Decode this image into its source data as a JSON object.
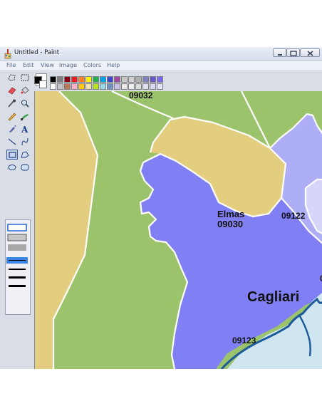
{
  "window": {
    "title": "Untitled - Paint",
    "controls": [
      "minimize-icon",
      "maximize-icon",
      "close-icon"
    ]
  },
  "menu": {
    "items": [
      "File",
      "Edit",
      "View",
      "Image",
      "Colors",
      "Help"
    ]
  },
  "tools": [
    "free-select-icon",
    "rect-select-icon",
    "eraser-icon",
    "fill-bucket-icon",
    "color-picker-icon",
    "magnifier-icon",
    "pencil-icon",
    "brush-icon",
    "airbrush-icon",
    "text-icon",
    "line-icon",
    "curve-icon",
    "rectangle-icon",
    "polygon-icon",
    "ellipse-icon",
    "rounded-rect-icon"
  ],
  "colors": {
    "foreground": "#000000",
    "background": "#ffffff",
    "palette_top": [
      "#000000",
      "#7f7f7f",
      "#880015",
      "#ed1c24",
      "#ff7f27",
      "#fff200",
      "#22b14c",
      "#00a2e8",
      "#3f48cc",
      "#a349a4",
      "#c8c8c8",
      "#d0d0d0",
      "#b0b0b0",
      "#8080c0",
      "#6a5acd",
      "#7b68ee"
    ],
    "palette_bottom": [
      "#ffffff",
      "#c3c3c3",
      "#b97a57",
      "#ffaec9",
      "#ffc90e",
      "#efe4b0",
      "#b5e61d",
      "#99d9ea",
      "#7092be",
      "#c8bfe7",
      "#e8e8e8",
      "#f0f0f0",
      "#dcdcdc",
      "#e0e0f0",
      "#d8d8f0",
      "#e6e6fa"
    ]
  },
  "map": {
    "labels": {
      "top_cut": "09032",
      "elmas_name": "Elmas",
      "elmas_code": "09030",
      "east_code": "09122",
      "city": "Cagliari",
      "center_code": "09123",
      "edge_cut": "0"
    },
    "colors": {
      "green": "#9bc36b",
      "tan": "#e3cd7e",
      "purple": "#8080f4",
      "lavender": "#aeaef6",
      "pale": "#d6d6fa",
      "water": "#cfe6f1",
      "coast": "#1d5a9a",
      "border": "#ffffff"
    }
  }
}
